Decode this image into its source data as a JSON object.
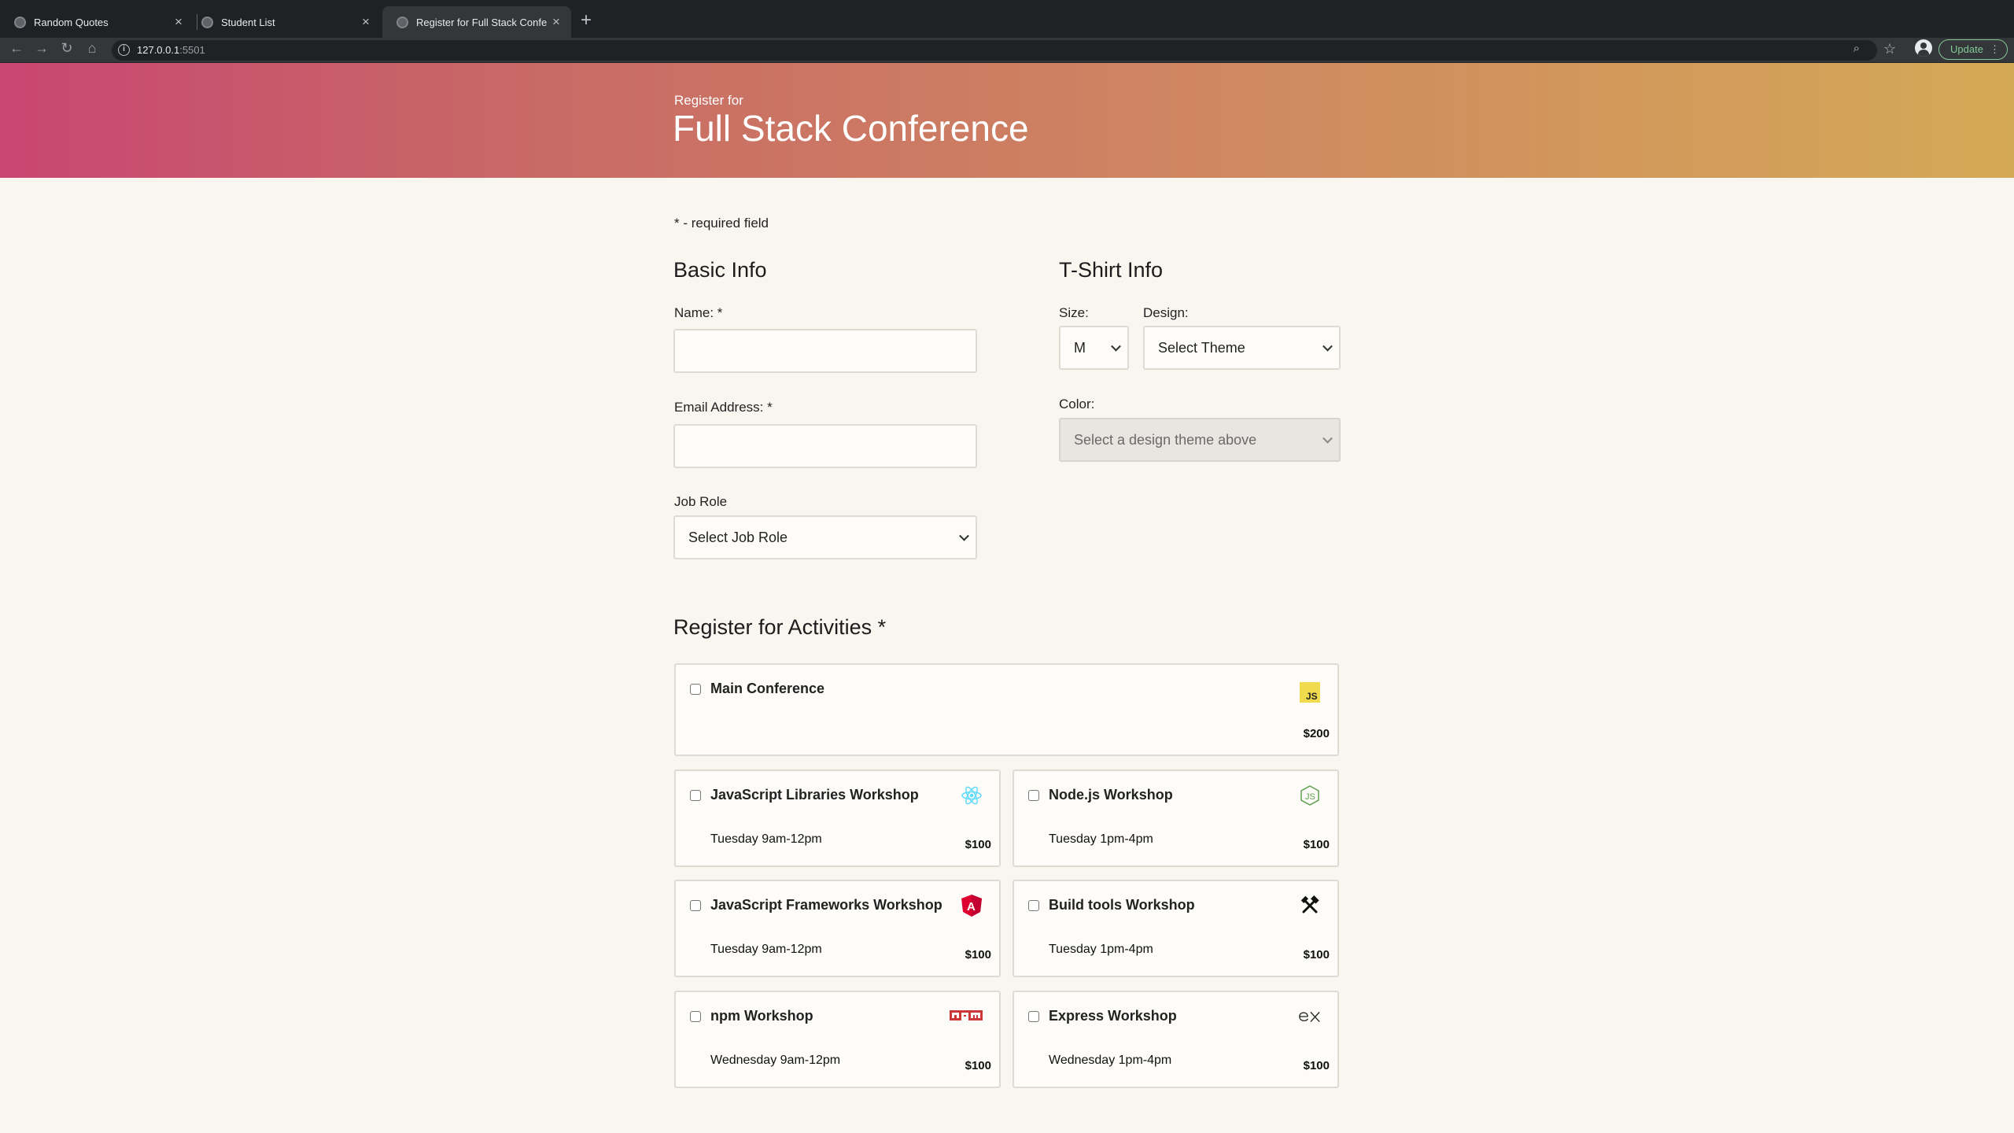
{
  "browser": {
    "tabs": [
      {
        "title": "Random Quotes",
        "active": false
      },
      {
        "title": "Student List",
        "active": false
      },
      {
        "title": "Register for Full Stack Conference",
        "active": true
      }
    ],
    "url_host": "127.0.0.1",
    "url_port": ":5501",
    "update_label": "Update"
  },
  "header": {
    "pre_title": "Register for",
    "title": "Full Stack Conference"
  },
  "required_note": "* - required field",
  "basic_info": {
    "heading": "Basic Info",
    "name_label": "Name: *",
    "email_label": "Email Address: *",
    "job_role_label": "Job Role",
    "job_role_selected": "Select Job Role"
  },
  "tshirt": {
    "heading": "T-Shirt Info",
    "size_label": "Size:",
    "size_selected": "M",
    "design_label": "Design:",
    "design_selected": "Select Theme",
    "color_label": "Color:",
    "color_selected": "Select a design theme above"
  },
  "activities": {
    "heading": "Register for Activities *",
    "items": [
      {
        "name": "Main Conference",
        "time": "",
        "cost": "$200",
        "icon": "javascript-icon"
      },
      {
        "name": "JavaScript Libraries Workshop",
        "time": "Tuesday 9am-12pm",
        "cost": "$100",
        "icon": "react-icon"
      },
      {
        "name": "Node.js Workshop",
        "time": "Tuesday 1pm-4pm",
        "cost": "$100",
        "icon": "nodejs-icon"
      },
      {
        "name": "JavaScript Frameworks Workshop",
        "time": "Tuesday 9am-12pm",
        "cost": "$100",
        "icon": "angular-icon"
      },
      {
        "name": "Build tools Workshop",
        "time": "Tuesday 1pm-4pm",
        "cost": "$100",
        "icon": "build-tools-icon"
      },
      {
        "name": "npm Workshop",
        "time": "Wednesday 9am-12pm",
        "cost": "$100",
        "icon": "npm-icon"
      },
      {
        "name": "Express Workshop",
        "time": "Wednesday 1pm-4pm",
        "cost": "$100",
        "icon": "express-icon"
      }
    ]
  },
  "colors": {
    "hero_gradient_start": "#c84672",
    "hero_gradient_end": "#d4a956",
    "page_background": "#f9f6f0"
  }
}
